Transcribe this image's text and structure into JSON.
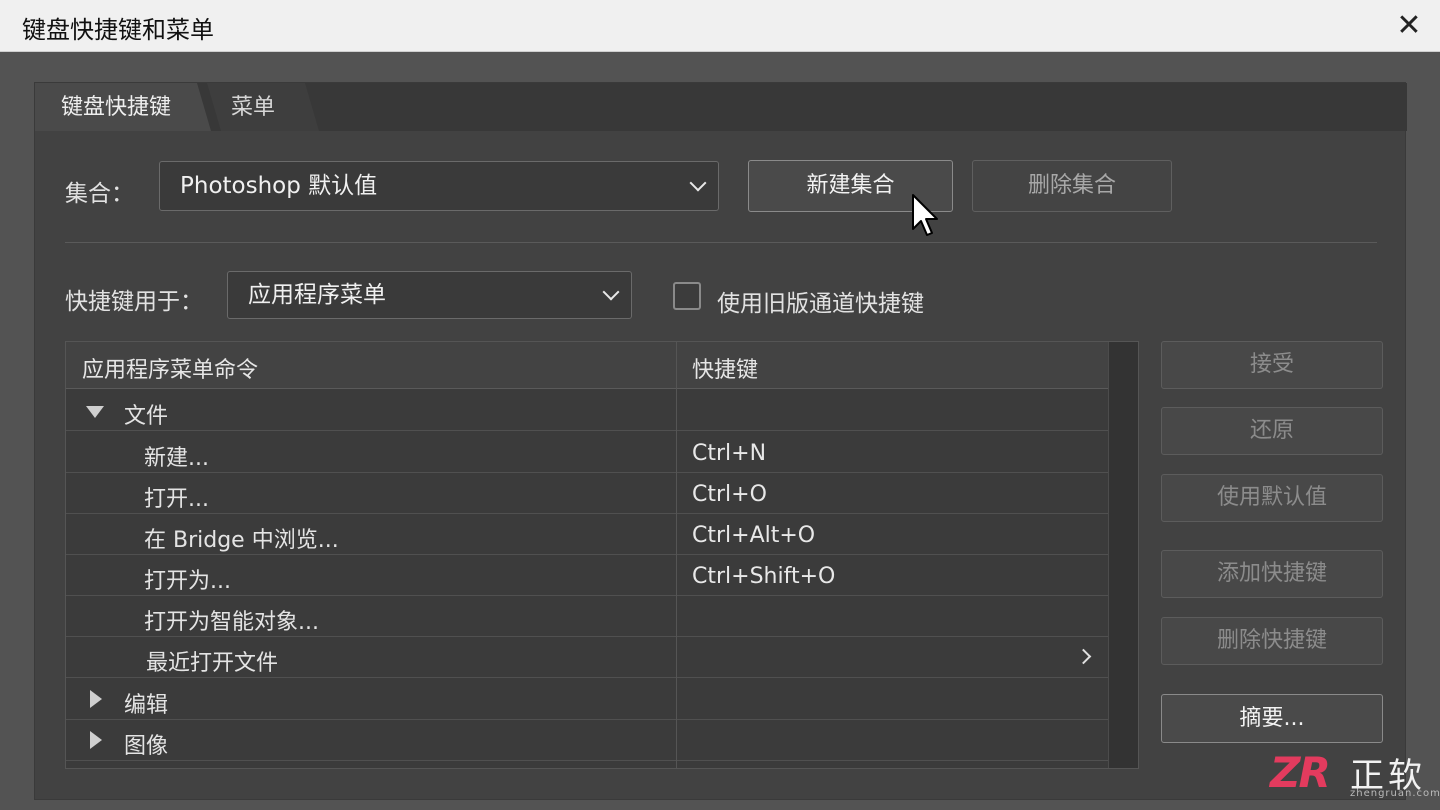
{
  "window": {
    "title": "键盘快捷键和菜单",
    "close_glyph": "✕"
  },
  "tabs": [
    {
      "label": "键盘快捷键",
      "active": true
    },
    {
      "label": "菜单",
      "active": false
    }
  ],
  "set": {
    "label": "集合：",
    "value": "Photoshop 默认值",
    "new_button": "新建集合",
    "delete_button": "删除集合"
  },
  "shortcuts_for": {
    "label": "快捷键用于：",
    "value": "应用程序菜单",
    "legacy_checkbox_label": "使用旧版通道快捷键",
    "legacy_checked": false
  },
  "table": {
    "headers": {
      "command": "应用程序菜单命令",
      "shortcut": "快捷键"
    },
    "rows": [
      {
        "command": "文件",
        "shortcut": "",
        "level": 0,
        "expanded": true
      },
      {
        "command": "新建...",
        "shortcut": "Ctrl+N",
        "level": 1
      },
      {
        "command": "打开...",
        "shortcut": "Ctrl+O",
        "level": 1
      },
      {
        "command": "在 Bridge 中浏览...",
        "shortcut": "Ctrl+Alt+O",
        "level": 1
      },
      {
        "command": "打开为...",
        "shortcut": "Ctrl+Shift+O",
        "level": 1
      },
      {
        "command": "打开为智能对象...",
        "shortcut": "",
        "level": 1
      },
      {
        "command": "最近打开文件",
        "shortcut": "",
        "level": 1,
        "has_submenu": true
      },
      {
        "command": "编辑",
        "shortcut": "",
        "level": 0,
        "expanded": false
      },
      {
        "command": "图像",
        "shortcut": "",
        "level": 0,
        "expanded": false
      }
    ]
  },
  "side_buttons": {
    "accept": "接受",
    "undo": "还原",
    "use_default": "使用默认值",
    "add_shortcut": "添加快捷键",
    "delete_shortcut": "删除快捷键",
    "summary": "摘要..."
  },
  "watermark": {
    "logo": "ZR",
    "name": "正软",
    "url": "zhengruan.com",
    "accent": "#e33b5e"
  }
}
